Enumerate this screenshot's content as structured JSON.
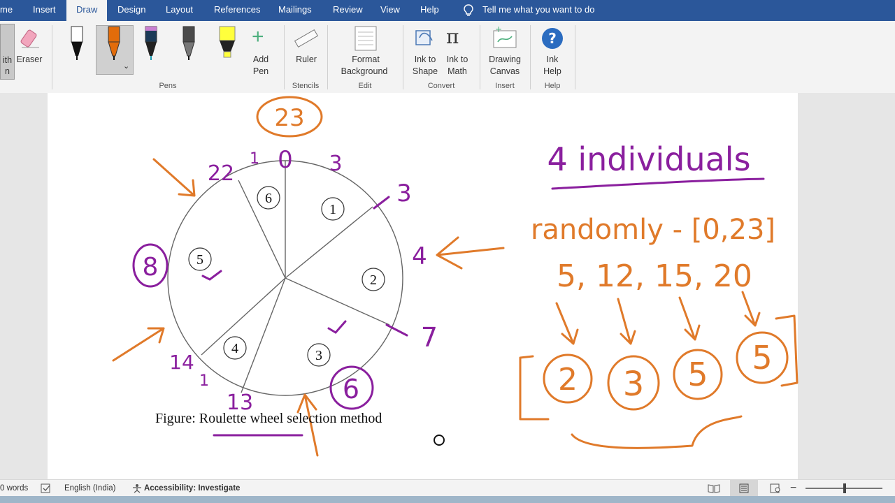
{
  "tabs": [
    {
      "label": "me"
    },
    {
      "label": "Insert"
    },
    {
      "label": "Draw",
      "active": true
    },
    {
      "label": "Design"
    },
    {
      "label": "Layout"
    },
    {
      "label": "References"
    },
    {
      "label": "Mailings"
    },
    {
      "label": "Review"
    },
    {
      "label": "View"
    },
    {
      "label": "Help"
    }
  ],
  "tell_me": "Tell me what you want to do",
  "ribbon": {
    "with_fragment": "ith",
    "with_fragment2": "n",
    "eraser": "Eraser",
    "add_pen_1": "Add",
    "add_pen_2": "Pen",
    "ruler": "Ruler",
    "format_bg_1": "Format",
    "format_bg_2": "Background",
    "ink_shape_1": "Ink to",
    "ink_shape_2": "Shape",
    "ink_math_1": "Ink to",
    "ink_math_2": "Math",
    "drawing_canvas_1": "Drawing",
    "drawing_canvas_2": "Canvas",
    "ink_help_1": "Ink",
    "ink_help_2": "Help",
    "groups": {
      "pens": "Pens",
      "stencils": "Stencils",
      "edit": "Edit",
      "convert": "Convert",
      "insert": "Insert",
      "help": "Help"
    }
  },
  "pen_colors": [
    "#111111",
    "#e36c0a",
    "#1b3a57",
    "#4a4a4a",
    "#ffff3c"
  ],
  "document": {
    "caption": "Figure: Roulette wheel selection method",
    "wheel_numbers": [
      "1",
      "2",
      "3",
      "4",
      "5",
      "6"
    ],
    "ink_colors": {
      "purple": "#8a1f9e",
      "orange": "#e07a2a"
    },
    "annotations": {
      "n23": "23",
      "n22": "22",
      "n1a": "1",
      "p0": "0",
      "n3a": "3",
      "n3b": "3",
      "n4": "4",
      "n8": "8",
      "n7": "7",
      "n14": "14",
      "n1b": "1",
      "n13": "13",
      "n6": "6",
      "title": "4 individuals",
      "randomly": "randomly - [0,23]",
      "picks": "5, 12, 15, 20",
      "results": [
        "2",
        "3",
        "5",
        "5"
      ]
    }
  },
  "status": {
    "words": "0 words",
    "language": "English (India)",
    "accessibility": "Accessibility: Investigate"
  }
}
